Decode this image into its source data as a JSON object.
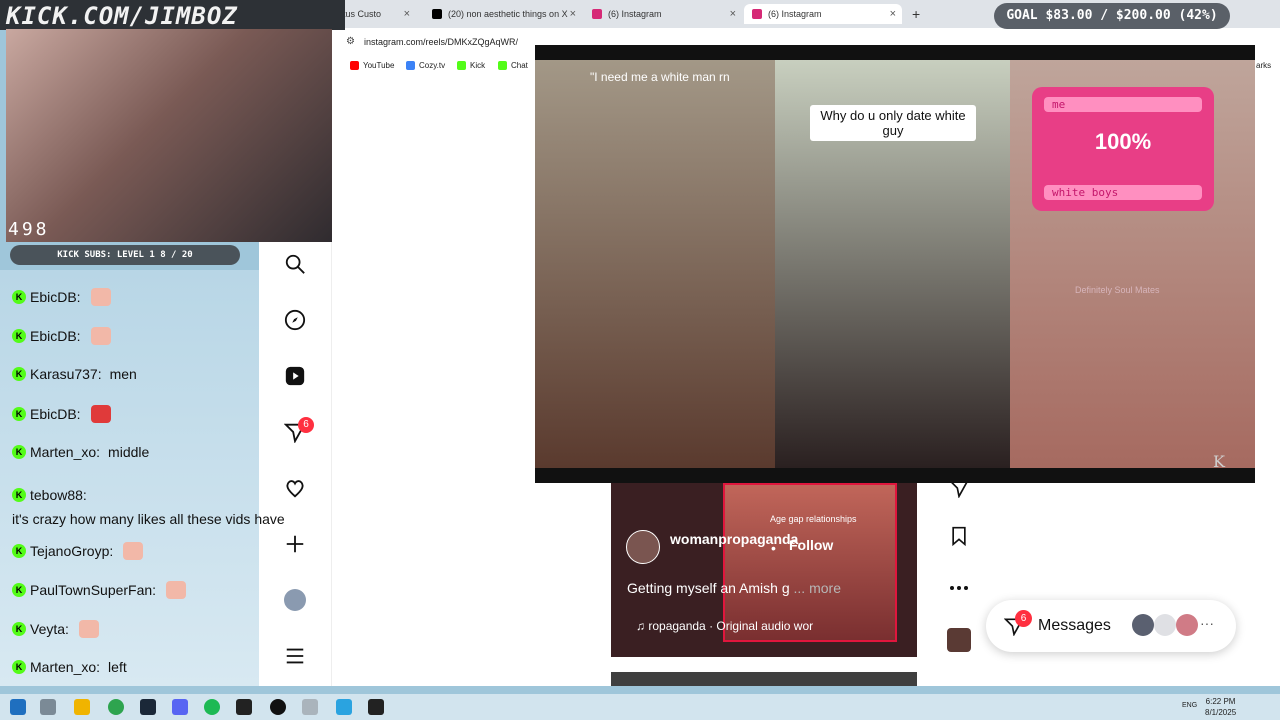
{
  "stream": {
    "watermark": "KICK.COM/JIMBOZ",
    "viewers": "498",
    "subs_label": "KICK SUBS: LEVEL 1 8 / 20",
    "goal": "GOAL $83.00 / $200.00 (42%)"
  },
  "browser": {
    "tabs": [
      {
        "label": "ptus Custo",
        "active": false
      },
      {
        "label": "(20) non aesthetic things on X",
        "active": false
      },
      {
        "label": "(6) Instagram",
        "active": false
      },
      {
        "label": "(6) Instagram",
        "active": true
      }
    ],
    "url": "instagram.com/reels/DMKxZQgAqWR/",
    "bookmarks": [
      "YouTube",
      "Cozy.tv",
      "Kick",
      "Chat"
    ],
    "bookmarks_right": "arks"
  },
  "chat": [
    {
      "user": "EbicDB:",
      "message": ""
    },
    {
      "user": "EbicDB:",
      "message": ""
    },
    {
      "user": "Karasu737:",
      "message": "men"
    },
    {
      "user": "EbicDB:",
      "message": ""
    },
    {
      "user": "Marten_xo:",
      "message": "middle"
    },
    {
      "user": "tebow88:",
      "message": "it's crazy how many likes all these vids have"
    },
    {
      "user": "TejanoGroyp:",
      "message": ""
    },
    {
      "user": "PaulTownSuperFan:",
      "message": ""
    },
    {
      "user": "Veyta:",
      "message": ""
    },
    {
      "user": "Marten_xo:",
      "message": "left"
    }
  ],
  "instagram": {
    "nav_badges": {
      "notifications": "6"
    },
    "video": {
      "caption_left": "\"I need me a white man rn",
      "caption_middle": "Why do u only date white guy",
      "meter_top": "me",
      "meter_percent": "100%",
      "meter_bottom": "white boys",
      "overlay_small": "Definitely Soul Mates",
      "corner_mark": "K"
    },
    "reel": {
      "tag": "Age gap relationships",
      "author": "womanpropaganda",
      "follow": "Follow",
      "dot": "•",
      "description": "Getting myself an Amish g",
      "more": "... more",
      "audio": "ropaganda · Original audio   wor"
    },
    "messages": {
      "label": "Messages",
      "badge": "6"
    }
  },
  "taskbar": {
    "lang": "ENG",
    "time": "6:22 PM",
    "date": "8/1/2025"
  }
}
